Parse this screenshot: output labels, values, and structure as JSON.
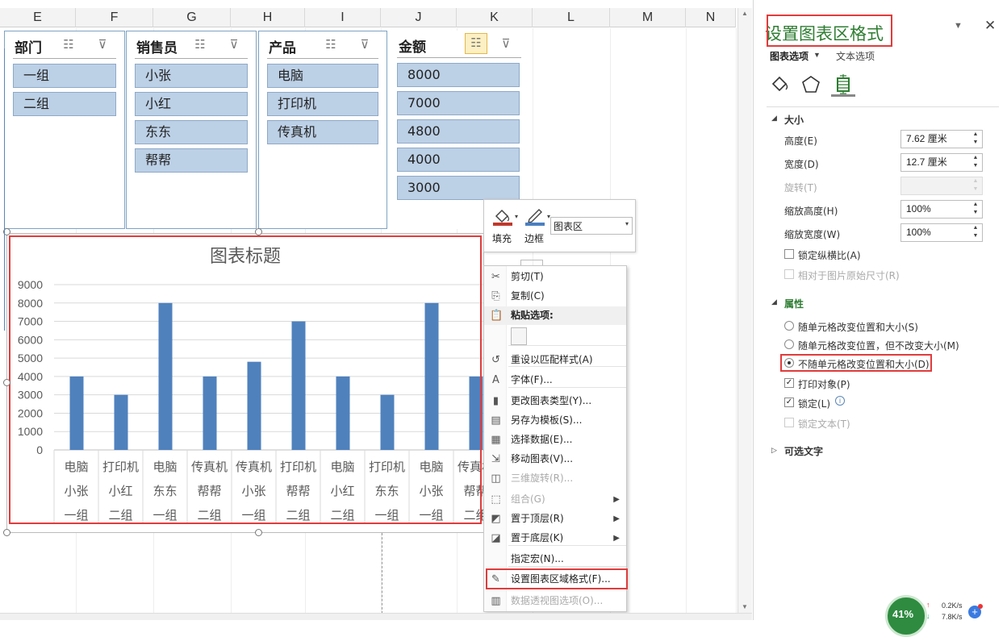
{
  "sheet": {
    "columns": [
      "E",
      "F",
      "G",
      "H",
      "I",
      "J",
      "K",
      "L",
      "M",
      "N"
    ]
  },
  "slicers": [
    {
      "title": "部门",
      "items": [
        "一组",
        "二组"
      ]
    },
    {
      "title": "销售员",
      "items": [
        "小张",
        "小红",
        "东东",
        "帮帮"
      ]
    },
    {
      "title": "产品",
      "items": [
        "电脑",
        "打印机",
        "传真机"
      ]
    },
    {
      "title": "金额",
      "items": [
        "8000",
        "7000",
        "4800",
        "4000",
        "3000"
      ]
    }
  ],
  "chart_data": {
    "type": "bar",
    "title": "图表标题",
    "xlabel": "",
    "ylabel": "",
    "ylim": [
      0,
      9000
    ],
    "yticks": [
      0,
      1000,
      2000,
      3000,
      4000,
      5000,
      6000,
      7000,
      8000,
      9000
    ],
    "categories": [
      [
        "电脑",
        "小张",
        "一组"
      ],
      [
        "打印机",
        "小红",
        "二组"
      ],
      [
        "电脑",
        "东东",
        "一组"
      ],
      [
        "传真机",
        "帮帮",
        "二组"
      ],
      [
        "传真机",
        "小张",
        "一组"
      ],
      [
        "打印机",
        "帮帮",
        "二组"
      ],
      [
        "电脑",
        "小红",
        "二组"
      ],
      [
        "打印机",
        "东东",
        "一组"
      ],
      [
        "电脑",
        "小张",
        "一组"
      ],
      [
        "传真机",
        "帮帮",
        "二组"
      ]
    ],
    "values": [
      4000,
      3000,
      8000,
      4000,
      4800,
      7000,
      4000,
      3000,
      8000,
      4000
    ],
    "bar_color": "#4f81bd",
    "grid": true
  },
  "mini_toolbar": {
    "fill_label": "填充",
    "border_label": "边框",
    "element_value": "图表区"
  },
  "context_menu": {
    "items": [
      {
        "label": "剪切(T)",
        "icon": "scissors-icon",
        "disabled": false
      },
      {
        "label": "复制(C)",
        "icon": "copy-icon",
        "disabled": false
      },
      {
        "label": "粘贴选项:",
        "icon": "paste-icon",
        "disabled": false,
        "header": true
      },
      {
        "label": "重设以匹配样式(A)",
        "icon": "reset-style-icon",
        "disabled": false
      },
      {
        "label": "字体(F)...",
        "icon": "font-icon",
        "disabled": false
      },
      {
        "label": "更改图表类型(Y)...",
        "icon": "chart-type-icon",
        "disabled": false
      },
      {
        "label": "另存为模板(S)...",
        "icon": "save-template-icon",
        "disabled": false
      },
      {
        "label": "选择数据(E)...",
        "icon": "select-data-icon",
        "disabled": false
      },
      {
        "label": "移动图表(V)...",
        "icon": "move-chart-icon",
        "disabled": false
      },
      {
        "label": "三维旋转(R)...",
        "icon": "rotate-3d-icon",
        "disabled": true
      },
      {
        "label": "组合(G)",
        "icon": "group-icon",
        "disabled": true,
        "submenu": true
      },
      {
        "label": "置于顶层(R)",
        "icon": "bring-front-icon",
        "disabled": false,
        "submenu": true
      },
      {
        "label": "置于底层(K)",
        "icon": "send-back-icon",
        "disabled": false,
        "submenu": true
      },
      {
        "label": "指定宏(N)...",
        "icon": "",
        "disabled": false
      },
      {
        "label": "设置图表区域格式(F)...",
        "icon": "format-chart-icon",
        "disabled": false
      },
      {
        "label": "数据透视图选项(O)...",
        "icon": "pivot-options-icon",
        "disabled": true
      }
    ]
  },
  "pane": {
    "title": "设置图表区格式",
    "tab_chart": "图表选项",
    "tab_text": "文本选项",
    "section_size": "大小",
    "height_label": "高度(E)",
    "height_value": "7.62 厘米",
    "width_label": "宽度(D)",
    "width_value": "12.7 厘米",
    "rotate_label": "旋转(T)",
    "scale_h_label": "缩放高度(H)",
    "scale_h_value": "100%",
    "scale_w_label": "缩放宽度(W)",
    "scale_w_value": "100%",
    "lock_ratio_label": "锁定纵横比(A)",
    "relative_label": "相对于图片原始尺寸(R)",
    "section_props": "属性",
    "radio1": "随单元格改变位置和大小(S)",
    "radio2": "随单元格改变位置，但不改变大小(M)",
    "radio3": "不随单元格改变位置和大小(D)",
    "print_label": "打印对象(P)",
    "locked_label": "锁定(L)",
    "lock_text_label": "锁定文本(T)",
    "section_alt": "可选文字"
  },
  "status": {
    "cpu": "41%",
    "up": "0.2K/s",
    "down": "7.8K/s"
  },
  "colors": {
    "accent_red": "#e03c3c",
    "slicer_item": "#bcd0e6",
    "green": "#2e7d32"
  }
}
